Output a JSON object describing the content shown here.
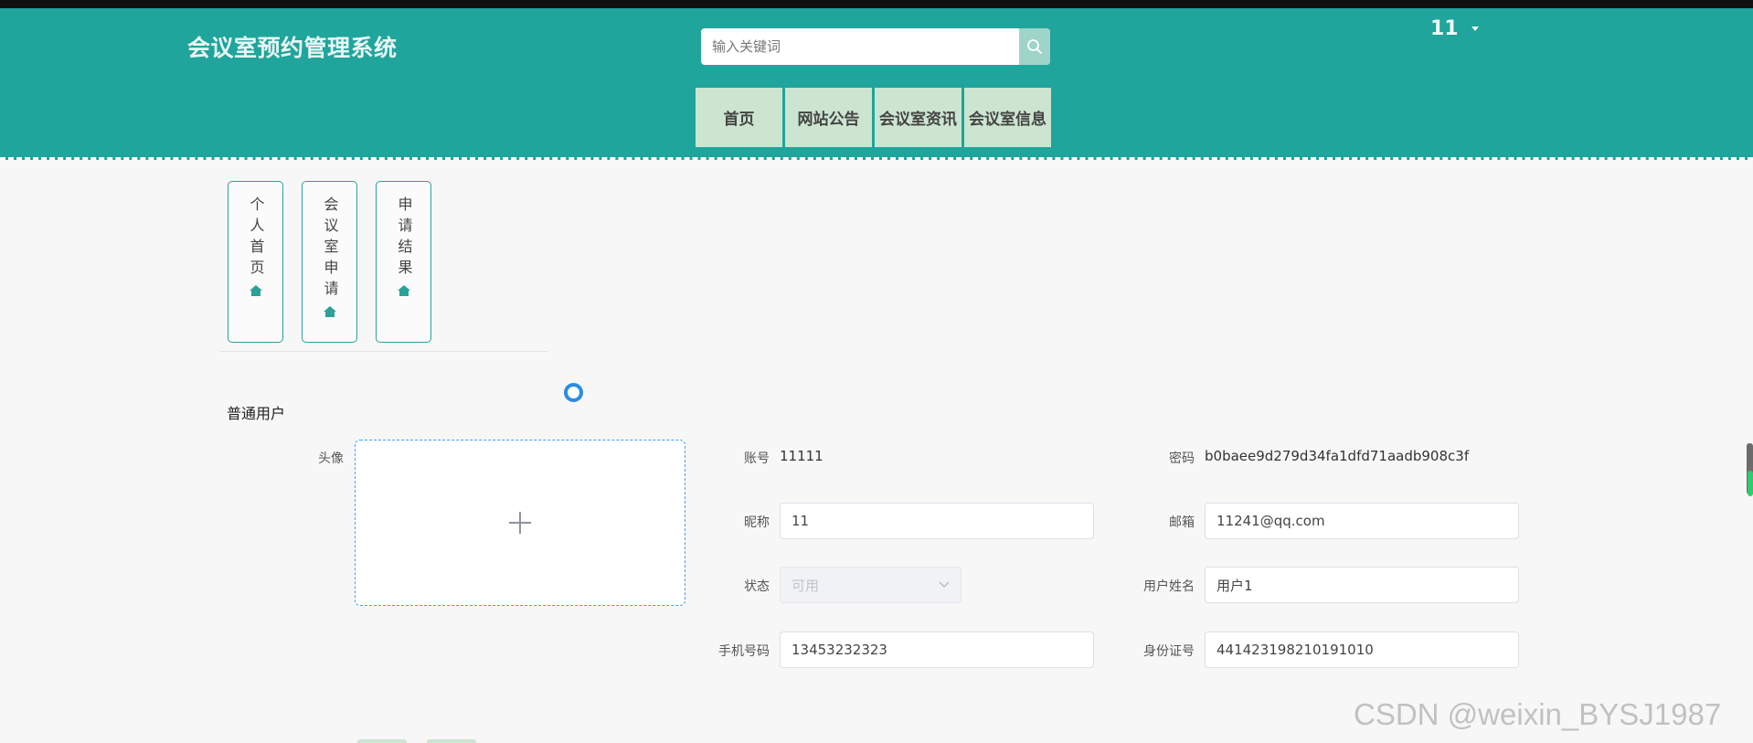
{
  "header": {
    "brand": "会议室预约管理系统",
    "search_placeholder": "输入关键词",
    "user_name": "11",
    "nav": [
      "首页",
      "网站公告",
      "会议室资讯",
      "会议室信息"
    ]
  },
  "side_tabs": [
    "个人首页",
    "会议室申请",
    "申请结果"
  ],
  "profile": {
    "section_title": "普通用户",
    "avatar_label": "头像",
    "account_label": "账号",
    "account_value": "11111",
    "password_label": "密码",
    "password_value": "b0baee9d279d34fa1dfd71aadb908c3f",
    "nickname_label": "昵称",
    "nickname_value": "11",
    "email_label": "邮箱",
    "email_value": "11241@qq.com",
    "status_label": "状态",
    "status_value": "可用",
    "realname_label": "用户姓名",
    "realname_value": "用户1",
    "phone_label": "手机号码",
    "phone_value": "13453232323",
    "idcard_label": "身份证号",
    "idcard_value": "441423198210191010"
  },
  "watermark": "CSDN @weixin_BYSJ1987",
  "colors": {
    "header_bg": "#1fa59b",
    "nav_bg": "#cce5d0",
    "accent": "#2ba297",
    "upload_border": "#409eff"
  }
}
